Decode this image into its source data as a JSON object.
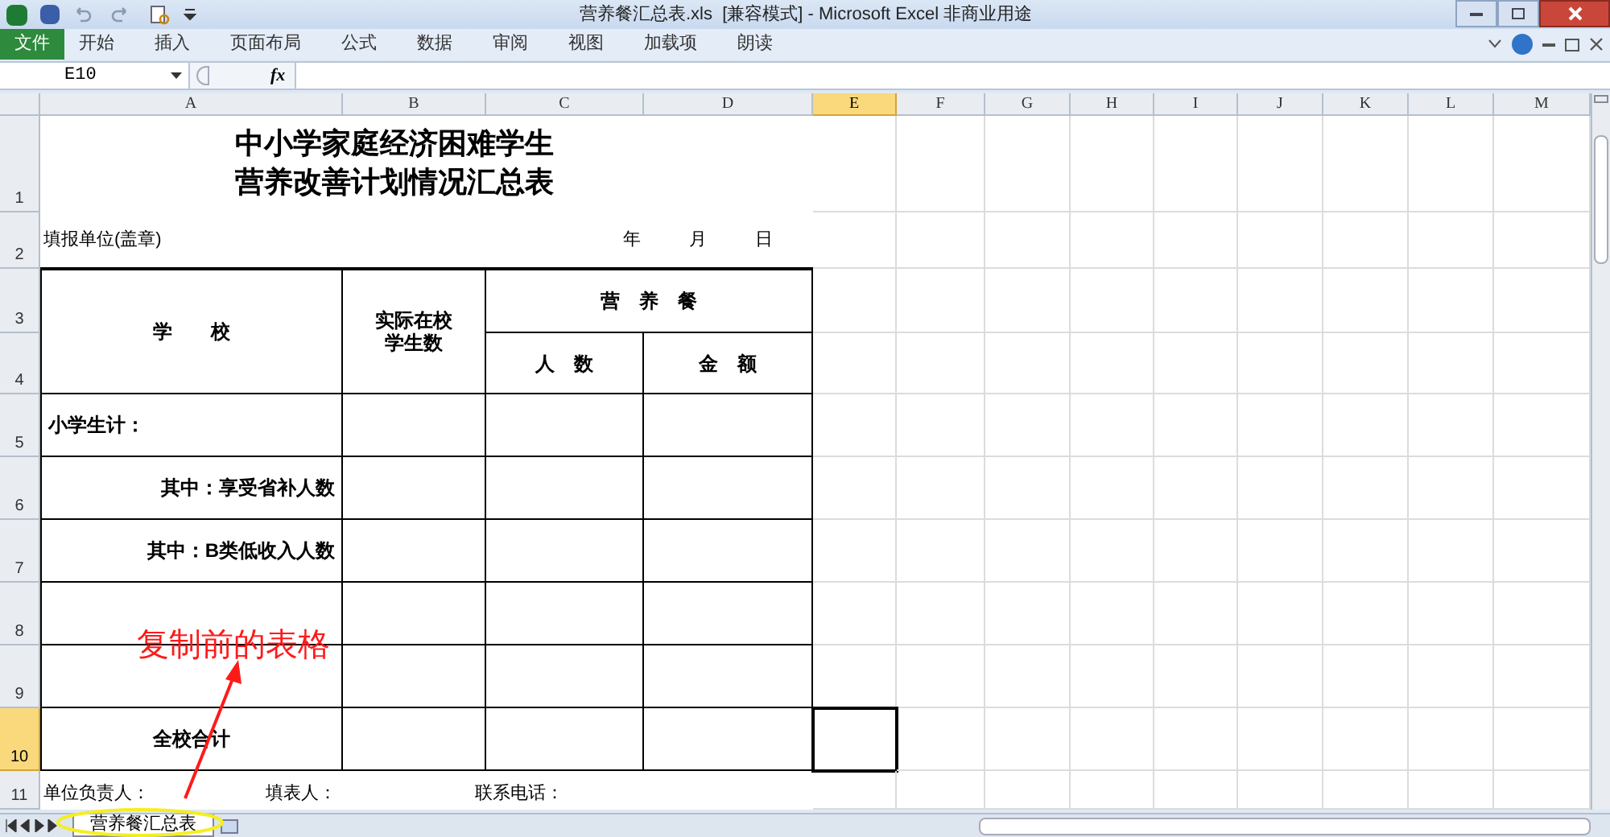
{
  "window": {
    "title": "营养餐汇总表.xls  [兼容模式] - Microsoft Excel 非商业用途"
  },
  "ribbon_tabs": [
    {
      "label": "文件",
      "kind": "file"
    },
    {
      "label": "开始",
      "kind": "tab"
    },
    {
      "label": "插入",
      "kind": "tab"
    },
    {
      "label": "页面布局",
      "kind": "tab"
    },
    {
      "label": "公式",
      "kind": "tab"
    },
    {
      "label": "数据",
      "kind": "tab"
    },
    {
      "label": "审阅",
      "kind": "tab"
    },
    {
      "label": "视图",
      "kind": "tab"
    },
    {
      "label": "加载项",
      "kind": "tab"
    },
    {
      "label": "朗读",
      "kind": "tab"
    }
  ],
  "formula_bar": {
    "name_box": "E10",
    "fx": "fx"
  },
  "columns": [
    {
      "label": "A",
      "selected": false
    },
    {
      "label": "B",
      "selected": false
    },
    {
      "label": "C",
      "selected": false
    },
    {
      "label": "D",
      "selected": false
    },
    {
      "label": "E",
      "selected": true
    },
    {
      "label": "F",
      "selected": false
    },
    {
      "label": "G",
      "selected": false
    },
    {
      "label": "H",
      "selected": false
    },
    {
      "label": "I",
      "selected": false
    },
    {
      "label": "J",
      "selected": false
    },
    {
      "label": "K",
      "selected": false
    },
    {
      "label": "L",
      "selected": false
    },
    {
      "label": "M",
      "selected": false
    }
  ],
  "rows": [
    {
      "label": "1",
      "selected": false
    },
    {
      "label": "2",
      "selected": false
    },
    {
      "label": "3",
      "selected": false
    },
    {
      "label": "4",
      "selected": false
    },
    {
      "label": "5",
      "selected": false
    },
    {
      "label": "6",
      "selected": false
    },
    {
      "label": "7",
      "selected": false
    },
    {
      "label": "8",
      "selected": false
    },
    {
      "label": "9",
      "selected": false
    },
    {
      "label": "10",
      "selected": true
    },
    {
      "label": "11",
      "selected": false
    }
  ],
  "sheet": {
    "title_lines": [
      "中小学家庭经济困难学生",
      "营养改善计划情况汇总表"
    ],
    "unit": "填报单位(盖章)",
    "date": [
      "年",
      "月",
      "日"
    ],
    "headers": {
      "school": "学　　校",
      "students": [
        "实际在校",
        "学生数"
      ],
      "meals": "营　养　餐",
      "count": "人　数",
      "amount": "金　额"
    },
    "body_rows": [
      {
        "label": "小学生计：",
        "kind": "left"
      },
      {
        "label": "其中：享受省补人数",
        "kind": "indent"
      },
      {
        "label": "其中：B类低收入人数",
        "kind": "indent"
      },
      {
        "kind": "blank"
      },
      {
        "kind": "blank"
      },
      {
        "label": "全校合计",
        "kind": "center"
      }
    ],
    "footer": [
      "单位负责人：",
      "填表人：",
      "联系电话："
    ]
  },
  "annotation": "复制前的表格",
  "sheet_tabs": [
    {
      "label": "营养餐汇总表",
      "selected": true
    }
  ]
}
